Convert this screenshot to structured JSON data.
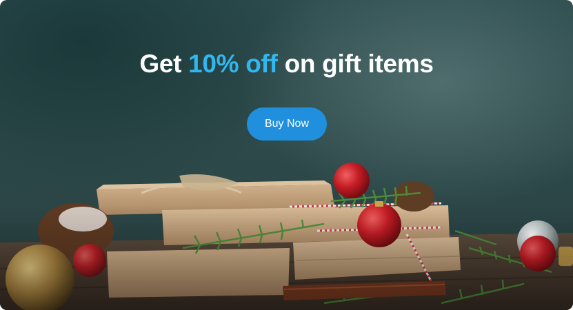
{
  "promo": {
    "headline_prefix": "Get",
    "headline_highlight": "10% off",
    "headline_suffix": "on gift items",
    "cta_label": "Buy Now"
  },
  "colors": {
    "accent": "#31b7f0",
    "button": "#1f8fde",
    "background": "#2f4e4f"
  }
}
